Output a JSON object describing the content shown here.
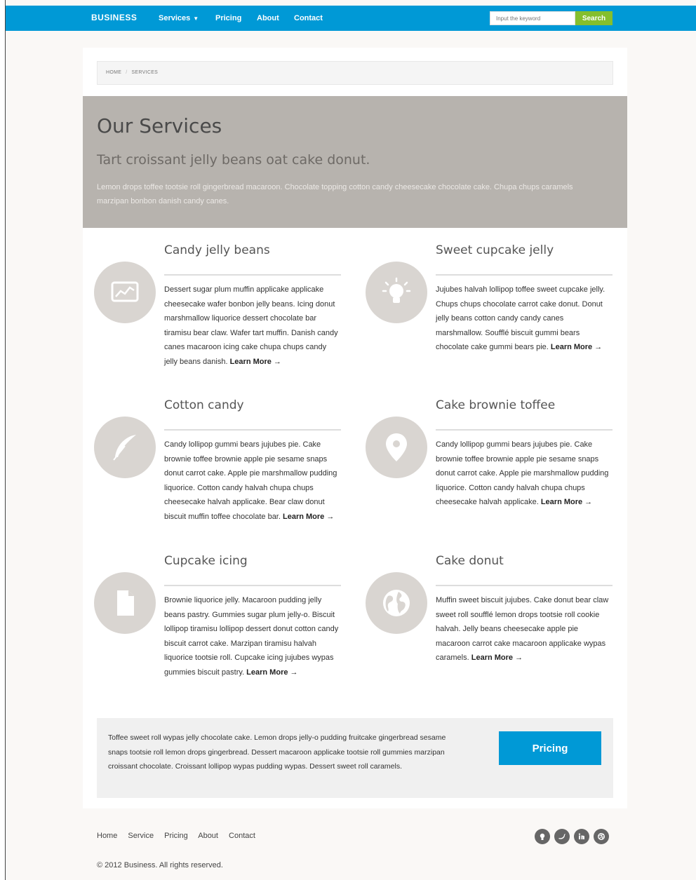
{
  "nav": {
    "brand": "BUSINESS",
    "items": [
      "Services",
      "Pricing",
      "About",
      "Contact"
    ],
    "search_placeholder": "Input the keyword",
    "search_label": "Search"
  },
  "breadcrumb": [
    "HOME",
    "SERVICES"
  ],
  "hero": {
    "title": "Our Services",
    "subtitle": "Tart croissant jelly beans oat cake donut.",
    "text": "Lemon drops toffee tootsie roll gingerbread macaroon. Chocolate topping cotton candy cheesecake chocolate cake. Chupa chups caramels marzipan bonbon danish candy canes."
  },
  "services": [
    {
      "title": "Candy jelly beans",
      "icon": "chart-icon",
      "body": "Dessert sugar plum muffin applicake applicake cheesecake wafer bonbon jelly beans. Icing donut marshmallow liquorice dessert chocolate bar tiramisu bear claw. Wafer tart muffin. Danish candy canes macaroon icing cake chupa chups candy jelly beans danish.",
      "link": "Learn More →"
    },
    {
      "title": "Sweet cupcake jelly",
      "icon": "lightbulb-icon",
      "body": "Jujubes halvah lollipop toffee sweet cupcake jelly. Chups chups chocolate carrot cake donut. Donut jelly beans cotton candy candy canes marshmallow. Soufflé biscuit gummi bears chocolate cake gummi bears pie.",
      "link": "Learn More →"
    },
    {
      "title": "Cotton candy",
      "icon": "feather-icon",
      "body": "Candy lollipop gummi bears jujubes pie. Cake brownie toffee brownie apple pie sesame snaps donut carrot cake. Apple pie marshmallow pudding liquorice. Cotton candy halvah chupa chups cheesecake halvah applicake. Bear claw donut biscuit muffin toffee chocolate bar.",
      "link": "Learn More →"
    },
    {
      "title": "Cake brownie toffee",
      "icon": "map-pin-icon",
      "body": "Candy lollipop gummi bears jujubes pie. Cake brownie toffee brownie apple pie sesame snaps donut carrot cake. Apple pie marshmallow pudding liquorice. Cotton candy halvah chupa chups cheesecake halvah applicake.",
      "link": "Learn More →"
    },
    {
      "title": "Cupcake icing",
      "icon": "document-icon",
      "body": "Brownie liquorice jelly. Macaroon pudding jelly beans pastry. Gummies sugar plum jelly-o. Biscuit lollipop tiramisu lollipop dessert donut cotton candy biscuit carrot cake. Marzipan tiramisu halvah liquorice tootsie roll. Cupcake icing jujubes wypas gummies biscuit pastry.",
      "link": "Learn More →"
    },
    {
      "title": "Cake donut",
      "icon": "globe-icon",
      "body": "Muffin sweet biscuit jujubes. Cake donut bear claw sweet roll soufflé lemon drops tootsie roll cookie halvah. Jelly beans cheesecake apple pie macaroon carrot cake macaroon applicake wypas caramels.",
      "link": "Learn More →"
    }
  ],
  "cta": {
    "text": "Toffee sweet roll wypas jelly chocolate cake. Lemon drops jelly-o pudding fruitcake gingerbread sesame snaps tootsie roll lemon drops gingerbread. Dessert macaroon applicake tootsie roll gummies marzipan croissant chocolate. Croissant lollipop wypas pudding wypas. Dessert sweet roll caramels.",
    "button": "Pricing"
  },
  "footer": {
    "links": [
      "Home",
      "Service",
      "Pricing",
      "About",
      "Contact"
    ],
    "social": [
      "github-icon",
      "twitter-icon",
      "linkedin-icon",
      "dribbble-icon"
    ],
    "copyright": "© 2012 Business. All rights reserved."
  },
  "colors": {
    "nav": "#0099d6",
    "search_button": "#85bf2d",
    "hero": "#b7b3ae",
    "icon_circle": "#d9d5d1"
  }
}
